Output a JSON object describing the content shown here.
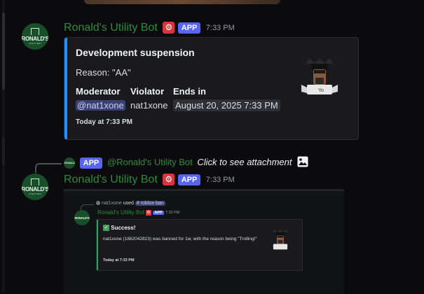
{
  "messages": [
    {
      "username": "Ronald's Utility Bot",
      "app_tag": "APP",
      "time": "7:33 PM",
      "avatar": {
        "text": "RONALD'S",
        "subtext": "UTILITY BOT"
      },
      "embed": {
        "accent_color": "#1e90ff",
        "title": "Development suspension",
        "reason": "Reason: \"AA\"",
        "fields": [
          {
            "name": "Moderator",
            "value": "@nat1xone"
          },
          {
            "name": "Violator",
            "value": "nat1xone"
          },
          {
            "name": "Ends in",
            "value": "August 20, 2025 7:33 PM"
          }
        ],
        "footer": "Today at 7:33 PM",
        "thumbnail": "roblox-avatar-thumbnail"
      }
    },
    {
      "reply": {
        "app_tag": "APP",
        "mention": "@Ronald's Utility Bot",
        "text": "Click to see attachment",
        "icon": "image-icon"
      },
      "username": "Ronald's Utility Bot",
      "app_tag": "APP",
      "time": "7:33 PM",
      "attachment": {
        "reply_user": "nat1xone",
        "reply_used": "used",
        "reply_command": "# roblox-ban",
        "username": "Ronald's Utility Bot",
        "app_tag": "APP",
        "time": "7:33 PM",
        "embed": {
          "accent_color": "#23a55a",
          "title": "Success!",
          "description": "nat1xone (1862042823) was banned for 1w, with the reason being \"Trolling!\"",
          "footer": "Today at 7:33 PM"
        }
      }
    }
  ],
  "colors": {
    "background": "#0b0b0d",
    "username": "#2d8a3e",
    "app_tag": "#5865f2",
    "gear_badge": "#d8363a"
  }
}
